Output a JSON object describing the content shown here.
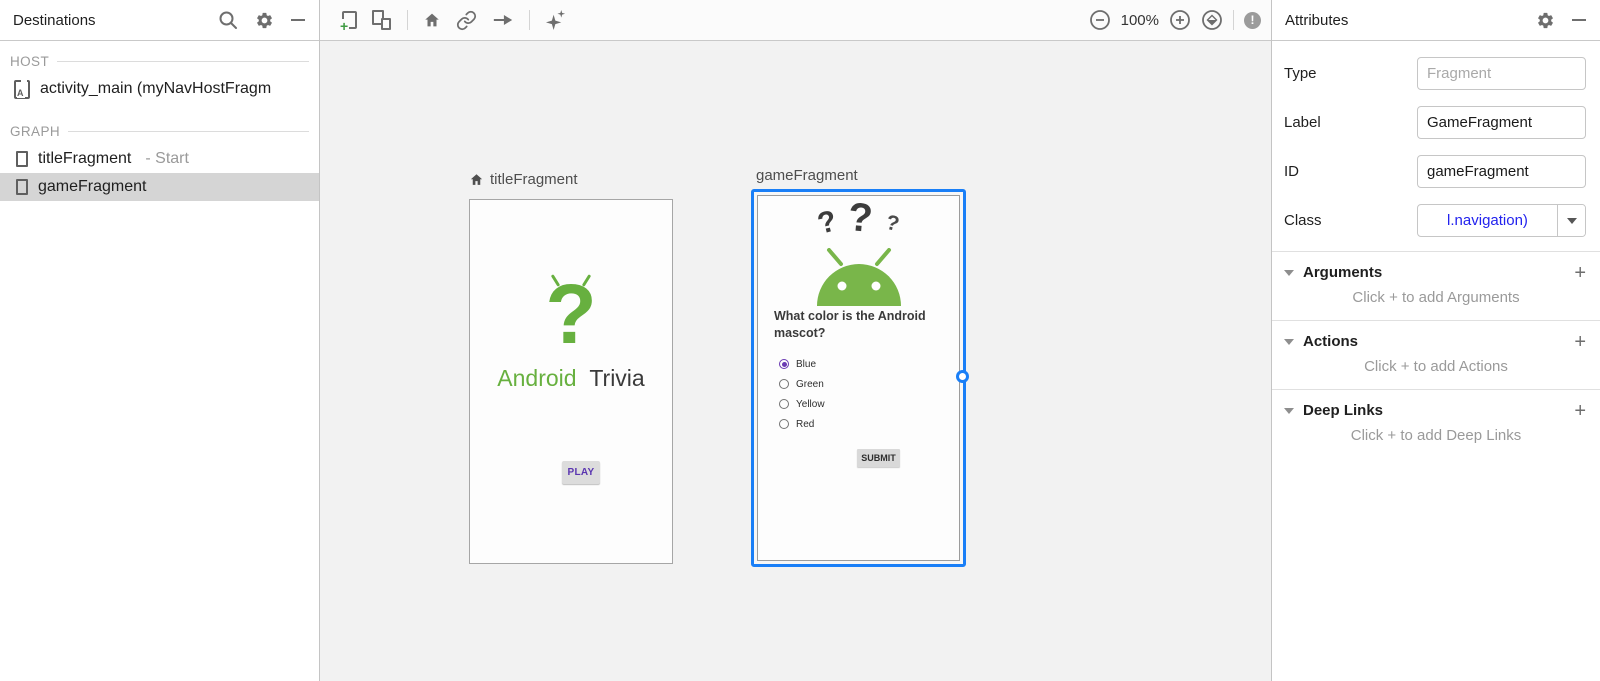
{
  "glyphs": {
    "plus": "+",
    "warning": "!",
    "activity_letter": "A"
  },
  "destinations": {
    "title": "Destinations",
    "host_header": "HOST",
    "host_item": "activity_main (myNavHostFragm",
    "graph_header": "GRAPH",
    "items": [
      {
        "label": "titleFragment",
        "suffix": "- Start",
        "selected": false
      },
      {
        "label": "gameFragment",
        "suffix": "",
        "selected": true
      }
    ]
  },
  "toolbar": {
    "zoom_level": "100%"
  },
  "canvas": {
    "title_fragment": {
      "label": "titleFragment",
      "logo_glyph": "?",
      "brand_green": "Android",
      "brand_dark": "Trivia",
      "button_label": "PLAY"
    },
    "game_fragment": {
      "label": "gameFragment",
      "question_marks": [
        "?",
        "?",
        "?"
      ],
      "question": "What color is the Android mascot?",
      "options": [
        "Blue",
        "Green",
        "Yellow",
        "Red"
      ],
      "selected_option": "Blue",
      "button_label": "SUBMIT"
    }
  },
  "attributes": {
    "title": "Attributes",
    "fields": [
      {
        "label": "Type",
        "value": "Fragment",
        "state": "disabled"
      },
      {
        "label": "Label",
        "value": "GameFragment",
        "state": "editable"
      },
      {
        "label": "ID",
        "value": "gameFragment",
        "state": "editable"
      },
      {
        "label": "Class",
        "value": "l.navigation)",
        "state": "combo"
      }
    ],
    "sections": [
      {
        "title": "Arguments",
        "hint": "Click + to add Arguments"
      },
      {
        "title": "Actions",
        "hint": "Click + to add Actions"
      },
      {
        "title": "Deep Links",
        "hint": "Click + to add Deep Links"
      }
    ]
  },
  "colors": {
    "selection_blue": "#1a7ff7",
    "android_green": "#67b03f",
    "mascot_green": "#79b64a",
    "accent_purple": "#6a3ab2",
    "class_link_blue": "#2222ee",
    "canvas_background": "#f2f2f2",
    "selected_row": "#d5d5d5"
  }
}
